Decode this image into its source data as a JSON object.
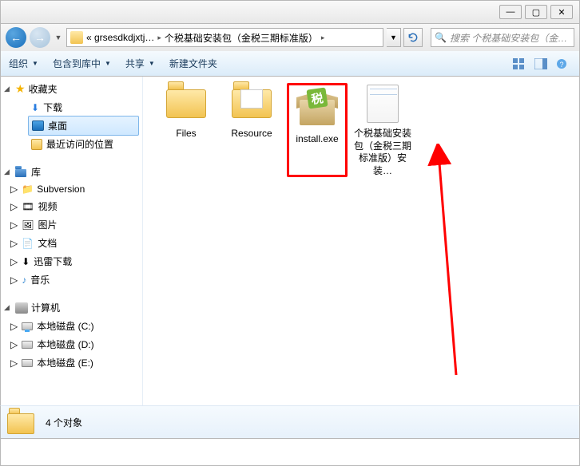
{
  "titlebar": {
    "minimize": "—",
    "maximize": "▢",
    "close": "✕"
  },
  "nav": {
    "back": "←",
    "forward": "→",
    "dropdown": "▼",
    "crumb1": "« grsesdkdjxtj…",
    "crumb2": "个税基础安装包（金税三期标准版）",
    "sep": "▸",
    "addr_dd": "▼",
    "refresh": "↻",
    "search_placeholder": "搜索 个税基础安装包（金…"
  },
  "toolbar": {
    "organize": "组织",
    "include": "包含到库中",
    "share": "共享",
    "newfolder": "新建文件夹",
    "dd": "▼"
  },
  "sidebar": {
    "favorites": "收藏夹",
    "fav_items": {
      "downloads": "下载",
      "desktop": "桌面",
      "recent": "最近访问的位置"
    },
    "libraries": "库",
    "lib_items": [
      "Subversion",
      "视频",
      "图片",
      "文档",
      "迅雷下载",
      "音乐"
    ],
    "computer": "计算机",
    "drives": [
      "本地磁盘 (C:)",
      "本地磁盘 (D:)",
      "本地磁盘 (E:)"
    ]
  },
  "items": [
    {
      "name": "Files",
      "type": "folder"
    },
    {
      "name": "Resource",
      "type": "folder-resource"
    },
    {
      "name": "install.exe",
      "type": "installer"
    },
    {
      "name": "个税基础安装包（金税三期标准版）安装…",
      "type": "document"
    }
  ],
  "status": {
    "text": "4 个对象"
  }
}
